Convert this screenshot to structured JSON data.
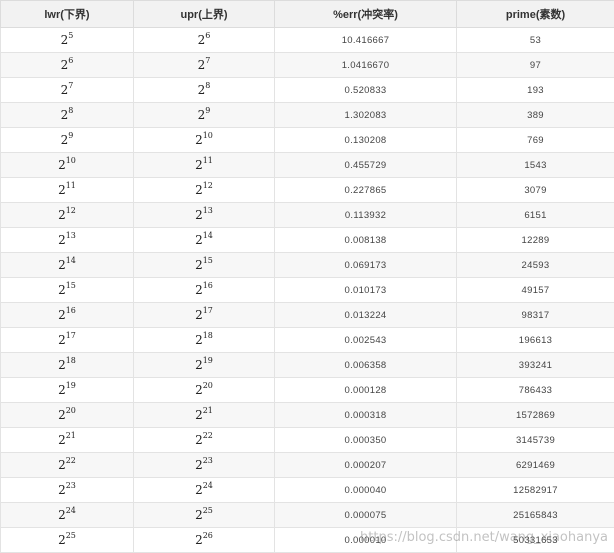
{
  "table": {
    "headers": [
      "lwr(下界)",
      "upr(上界)",
      "%err(冲突率)",
      "prime(素数)"
    ],
    "base": "2",
    "rows": [
      {
        "lwr_exp": "5",
        "upr_exp": "6",
        "err": "10.416667",
        "prime": "53"
      },
      {
        "lwr_exp": "6",
        "upr_exp": "7",
        "err": "1.0416670",
        "prime": "97"
      },
      {
        "lwr_exp": "7",
        "upr_exp": "8",
        "err": "0.520833",
        "prime": "193"
      },
      {
        "lwr_exp": "8",
        "upr_exp": "9",
        "err": "1.302083",
        "prime": "389"
      },
      {
        "lwr_exp": "9",
        "upr_exp": "10",
        "err": "0.130208",
        "prime": "769"
      },
      {
        "lwr_exp": "10",
        "upr_exp": "11",
        "err": "0.455729",
        "prime": "1543"
      },
      {
        "lwr_exp": "11",
        "upr_exp": "12",
        "err": "0.227865",
        "prime": "3079"
      },
      {
        "lwr_exp": "12",
        "upr_exp": "13",
        "err": "0.113932",
        "prime": "6151"
      },
      {
        "lwr_exp": "13",
        "upr_exp": "14",
        "err": "0.008138",
        "prime": "12289"
      },
      {
        "lwr_exp": "14",
        "upr_exp": "15",
        "err": "0.069173",
        "prime": "24593"
      },
      {
        "lwr_exp": "15",
        "upr_exp": "16",
        "err": "0.010173",
        "prime": "49157"
      },
      {
        "lwr_exp": "16",
        "upr_exp": "17",
        "err": "0.013224",
        "prime": "98317"
      },
      {
        "lwr_exp": "17",
        "upr_exp": "18",
        "err": "0.002543",
        "prime": "196613"
      },
      {
        "lwr_exp": "18",
        "upr_exp": "19",
        "err": "0.006358",
        "prime": "393241"
      },
      {
        "lwr_exp": "19",
        "upr_exp": "20",
        "err": "0.000128",
        "prime": "786433"
      },
      {
        "lwr_exp": "20",
        "upr_exp": "21",
        "err": "0.000318",
        "prime": "1572869"
      },
      {
        "lwr_exp": "21",
        "upr_exp": "22",
        "err": "0.000350",
        "prime": "3145739"
      },
      {
        "lwr_exp": "22",
        "upr_exp": "23",
        "err": "0.000207",
        "prime": "6291469"
      },
      {
        "lwr_exp": "23",
        "upr_exp": "24",
        "err": "0.000040",
        "prime": "12582917"
      },
      {
        "lwr_exp": "24",
        "upr_exp": "25",
        "err": "0.000075",
        "prime": "25165843"
      },
      {
        "lwr_exp": "25",
        "upr_exp": "26",
        "err": "0.000010",
        "prime": "50331653"
      }
    ]
  },
  "watermark": "https://blog.csdn.net/wang_xiaohanya",
  "colors": {
    "header_bg": "#f2f2f2",
    "alt_row_bg": "#f7f7f7",
    "border": "#e3e3e3",
    "text": "#333333"
  }
}
